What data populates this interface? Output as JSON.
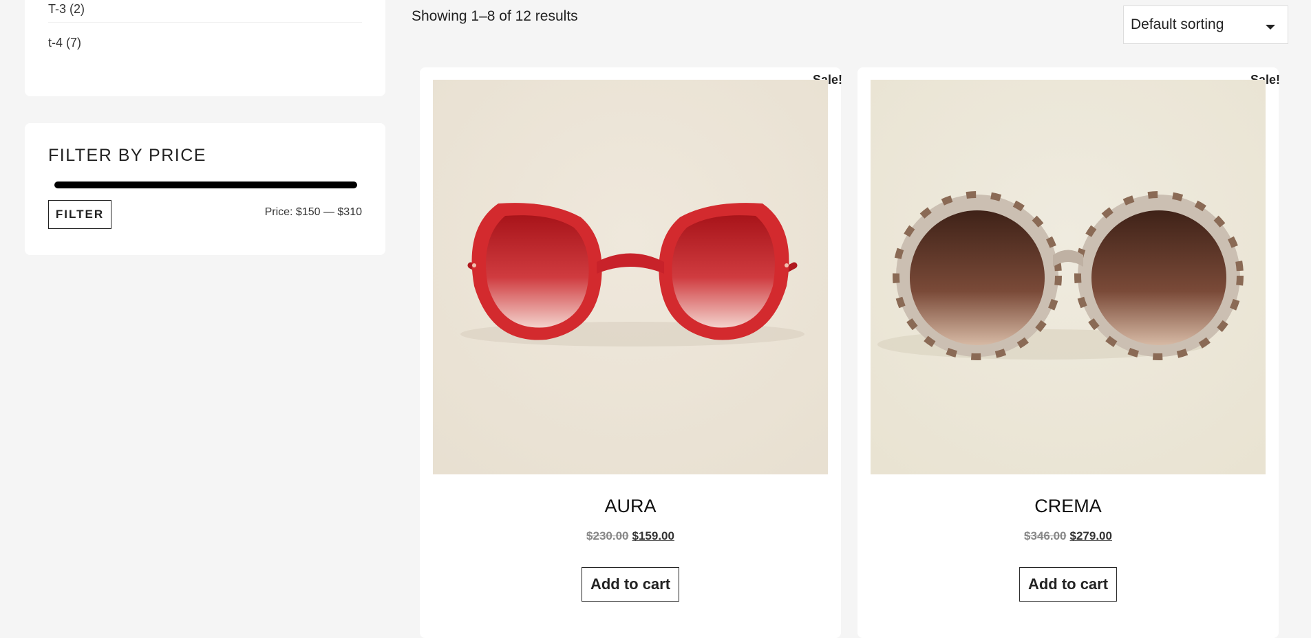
{
  "sidebar": {
    "categories": [
      {
        "label": "T-3 (2)"
      },
      {
        "label": "t-4 (7)"
      }
    ],
    "price_filter": {
      "title": "FILTER BY PRICE",
      "button_label": "FILTER",
      "range_text": "Price: $150 — $310",
      "min": 150,
      "max": 310
    }
  },
  "toolbar": {
    "result_count": "Showing 1–8 of 12 results",
    "sort_value": "Default sorting"
  },
  "products": [
    {
      "badge": "Sale!",
      "name": "AURA",
      "old_price": "$230.00",
      "new_price": "$159.00",
      "button_label": "Add to cart",
      "image_icon": "red-round-sunglasses-image"
    },
    {
      "badge": "Sale!",
      "name": "CREMA",
      "old_price": "$346.00",
      "new_price": "$279.00",
      "button_label": "Add to cart",
      "image_icon": "tortoise-round-sunglasses-image"
    }
  ],
  "colors": {
    "page_bg": "#f5f5f5",
    "card_bg": "#ffffff",
    "text": "#222222",
    "old_price": "#888888"
  }
}
